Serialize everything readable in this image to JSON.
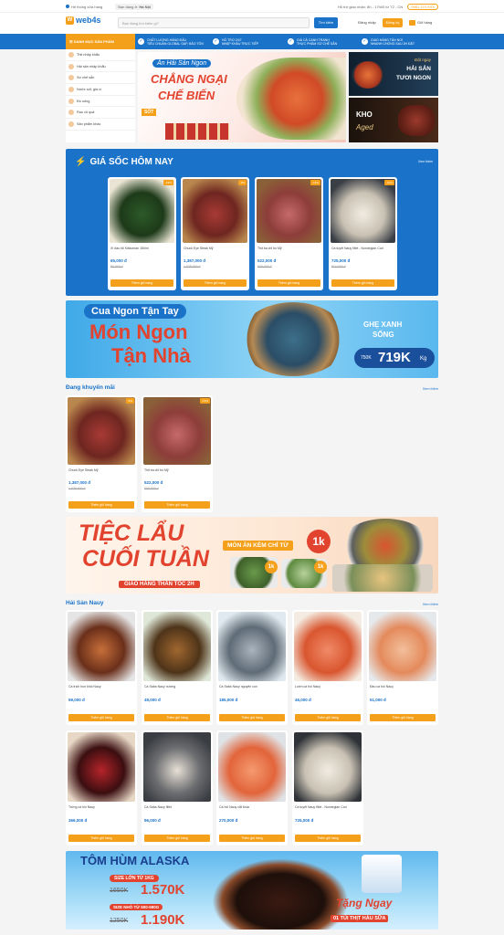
{
  "topbar": {
    "left": "Hệ thống cửa hàng",
    "location": "Bạn đang ở:",
    "city": "Hà Nội",
    "hotline": "Hỗ trợ giao nhận: 8h - 17h00 từ T2 - CN",
    "phone": "0981 174 XXX"
  },
  "header": {
    "logo": "web4s",
    "search_placeholder": "Bạn đang tìm kiếm gì?",
    "search_btn": "Tìm kiếm",
    "login": "Đăng nhập",
    "register": "Đăng ký",
    "cart": "Giỏ hàng",
    "cart_count": "0"
  },
  "nav": {
    "categories_label": "DANH MỤC SẢN PHẨM",
    "features": [
      {
        "title": "CHẤT LƯỢNG HÀNG ĐẦU",
        "sub": "TIÊU CHUẨN GLOBAL GAP, BẢO TỒN"
      },
      {
        "title": "HỖ TRỢ 24/7",
        "sub": "NHẬP KHẨU TRỰC TIẾP"
      },
      {
        "title": "GIÁ CẢ CẠNH TRANH",
        "sub": "THỰC PHẨM SƠ CHẾ SẴN"
      },
      {
        "title": "GIAO HÀNG TẬN NƠI",
        "sub": "NHANH CHÓNG SAU 2H ĐẶT"
      }
    ]
  },
  "sidebar": [
    "Thịt nhập khẩu",
    "Hải sản nhập khẩu",
    "Sơ chế sẵn",
    "Nước sốt, gia vị",
    "Đồ uống",
    "Rau củ quả",
    "Sản phẩm khác"
  ],
  "hero": {
    "line1": "Ăn Hải Sản Ngon",
    "line2": "CHẲNG NGẠI",
    "line3": "CHẾ BIẾN",
    "tag": "SỐT",
    "side1a": "Đặt ngay",
    "side1b": "HẢI SẢN",
    "side1c": "TƯƠI NGON",
    "side2a": "KHO",
    "side2b": "Aged"
  },
  "flash": {
    "title": "GIÁ SỐC HÔM NAY",
    "more": "Xem thêm",
    "items": [
      {
        "name": "Xì dầu tỏi Kikkoman 150ml",
        "price": "65,000 đ",
        "old": "80,000 đ",
        "badge": "-19%",
        "add": "Thêm giỏ hàng"
      },
      {
        "name": "Chuck Eye Steak Mỹ",
        "price": "1,387,000 đ",
        "old": "1,528,000 đ",
        "badge": "-9%",
        "add": "Thêm giỏ hàng"
      },
      {
        "name": "Thịt ba chỉ bò Mỹ",
        "price": "522,000 đ",
        "old": "600,000 đ",
        "badge": "-13%",
        "add": "Thêm giỏ hàng"
      },
      {
        "name": "Cá tuyết Nauy fillet - Norwegian Cod",
        "price": "725,000 đ",
        "old": "810,000 đ",
        "badge": "-10%",
        "add": "Thêm giỏ hàng"
      }
    ]
  },
  "crab": {
    "top": "Cua Ngon Tận Tay",
    "mid1": "Món Ngon",
    "mid2": "Tận Nhà",
    "r1": "GHẸ XANH",
    "r2": "SỐNG",
    "oldp": "750K",
    "newp": "719K",
    "unit": "Kg"
  },
  "promo": {
    "title": "Đang khuyến mãi",
    "more": "Xem thêm",
    "items": [
      {
        "name": "Chuck Eye Steak Mỹ",
        "price": "1,387,000 đ",
        "old": "1,528,000 đ",
        "badge": "-9%",
        "add": "Thêm giỏ hàng"
      },
      {
        "name": "Thịt ba chỉ bò Mỹ",
        "price": "522,000 đ",
        "old": "600,000 đ",
        "badge": "-13%",
        "add": "Thêm giỏ hàng"
      }
    ]
  },
  "hotpot": {
    "l1": "TIỆC LẨU",
    "l2": "CUỐI TUẦN",
    "r1": "MÓN ĂN KÈM CHỈ TỪ",
    "r2": "1k",
    "ship": "GIAO HÀNG THẦN TỐC 2H",
    "t1": "1k",
    "t2": "1k"
  },
  "nauy": {
    "title": "Hải Sản Nauy",
    "more": "Xem thêm",
    "items": [
      {
        "name": "Cá trích hun khói Nauy",
        "price": "59,000 đ",
        "add": "Thêm giỏ hàng"
      },
      {
        "name": "Cá Saba Nauy nướng",
        "price": "49,000 đ",
        "add": "Thêm giỏ hàng"
      },
      {
        "name": "Cá Saba Nauy nguyên con",
        "price": "185,000 đ",
        "add": "Thêm giỏ hàng"
      },
      {
        "name": "Lườn cá hồi Nauy",
        "price": "46,000 đ",
        "add": "Thêm giỏ hàng"
      },
      {
        "name": "Đầu cá hồi Nauy",
        "price": "51,000 đ",
        "add": "Thêm giỏ hàng"
      },
      {
        "name": "Trứng cá hồi Nauy",
        "price": "366,000 đ",
        "add": "Thêm giỏ hàng"
      },
      {
        "name": "Cá Saba Nauy fillet",
        "price": "96,000 đ",
        "add": "Thêm giỏ hàng"
      },
      {
        "name": "Cá hồi Nauy cắt khúc",
        "price": "270,000 đ",
        "add": "Thêm giỏ hàng"
      },
      {
        "name": "Cá tuyết Nauy fillet - Norwegian Cod",
        "price": "725,000 đ",
        "add": "Thêm giỏ hàng"
      }
    ]
  },
  "lobster": {
    "title": "TÔM HÙM ALASKA",
    "s1": "SIZE LỚN TỪ 1KG",
    "o1": "1650K",
    "n1": "1.570K",
    "s2": "SIZE NHỎ TỪ 500-590G",
    "o2": "1250K",
    "n2": "1.190K",
    "g1": "Tặng Ngay",
    "g2": "01 TÚI THỊT HÀU SỮA"
  },
  "colors": {
    "primary": "#1a73c9",
    "accent": "#f5a01a"
  }
}
